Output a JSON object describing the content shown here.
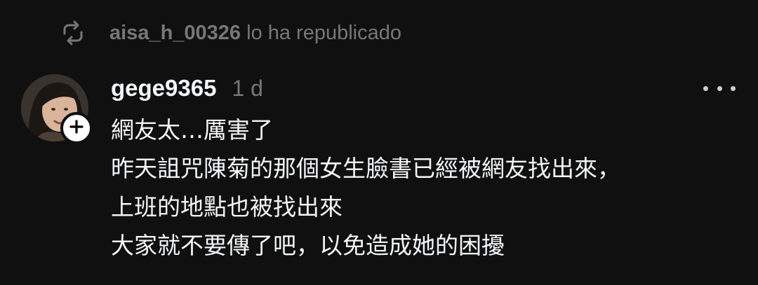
{
  "repost": {
    "icon": "repost-icon",
    "username": "aisa_h_00326",
    "suffix": " lo ha republicado"
  },
  "post": {
    "author": "gege9365",
    "time": "1 d",
    "avatar_icon": "avatar",
    "follow_icon": "plus-icon",
    "more_icon": "more-icon",
    "lines": [
      "網友太…厲害了",
      "昨天詛咒陳菊的那個女生臉書已經被網友找出來，",
      "上班的地點也被找出來",
      "大家就不要傳了吧，以免造成她的困擾"
    ]
  },
  "colors": {
    "background": "#101010",
    "primary_text": "#f3f5f7",
    "secondary_text": "#777777"
  }
}
